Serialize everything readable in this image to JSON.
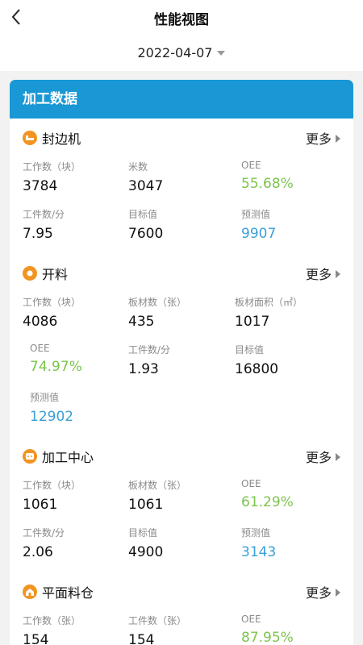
{
  "header": {
    "title": "性能视图",
    "date": "2022-04-07"
  },
  "card": {
    "title": "加工数据",
    "more_label": "更多",
    "sections": [
      {
        "title": "封边机",
        "icon": "bed-icon",
        "metrics": [
          {
            "label": "工作数（块）",
            "value": "3784"
          },
          {
            "label": "米数",
            "value": "3047"
          },
          {
            "label": "OEE",
            "value": "55.68%"
          },
          {
            "label": "工件数/分",
            "value": "7.95"
          },
          {
            "label": "目标值",
            "value": "7600"
          },
          {
            "label": "预测值",
            "value": "9907"
          }
        ]
      },
      {
        "title": "开料",
        "icon": "circle-icon",
        "metrics": [
          {
            "label": "工作数（块）",
            "value": "4086"
          },
          {
            "label": "板材数（张）",
            "value": "435"
          },
          {
            "label": "板材面积（㎡）",
            "value": "1017"
          },
          {
            "label": "OEE",
            "value": "74.97%"
          },
          {
            "label": "工件数/分",
            "value": "1.93"
          },
          {
            "label": "目标值",
            "value": "16800"
          },
          {
            "label": "预测值",
            "value": "12902"
          }
        ]
      },
      {
        "title": "加工中心",
        "icon": "machine-icon",
        "metrics": [
          {
            "label": "工作数（块）",
            "value": "1061"
          },
          {
            "label": "板材数（张）",
            "value": "1061"
          },
          {
            "label": "OEE",
            "value": "61.29%"
          },
          {
            "label": "工件数/分",
            "value": "2.06"
          },
          {
            "label": "目标值",
            "value": "4900"
          },
          {
            "label": "预测值",
            "value": "3143"
          }
        ]
      },
      {
        "title": "平面料仓",
        "icon": "warehouse-icon",
        "metrics": [
          {
            "label": "工作数（张）",
            "value": "154"
          },
          {
            "label": "工件数（张）",
            "value": "154"
          },
          {
            "label": "OEE",
            "value": "87.95%"
          }
        ]
      }
    ]
  },
  "colors": {
    "accent": "#1a98d5",
    "icon": "#f29422",
    "oee": "#7dc44d",
    "forecast": "#3a9fd8"
  }
}
